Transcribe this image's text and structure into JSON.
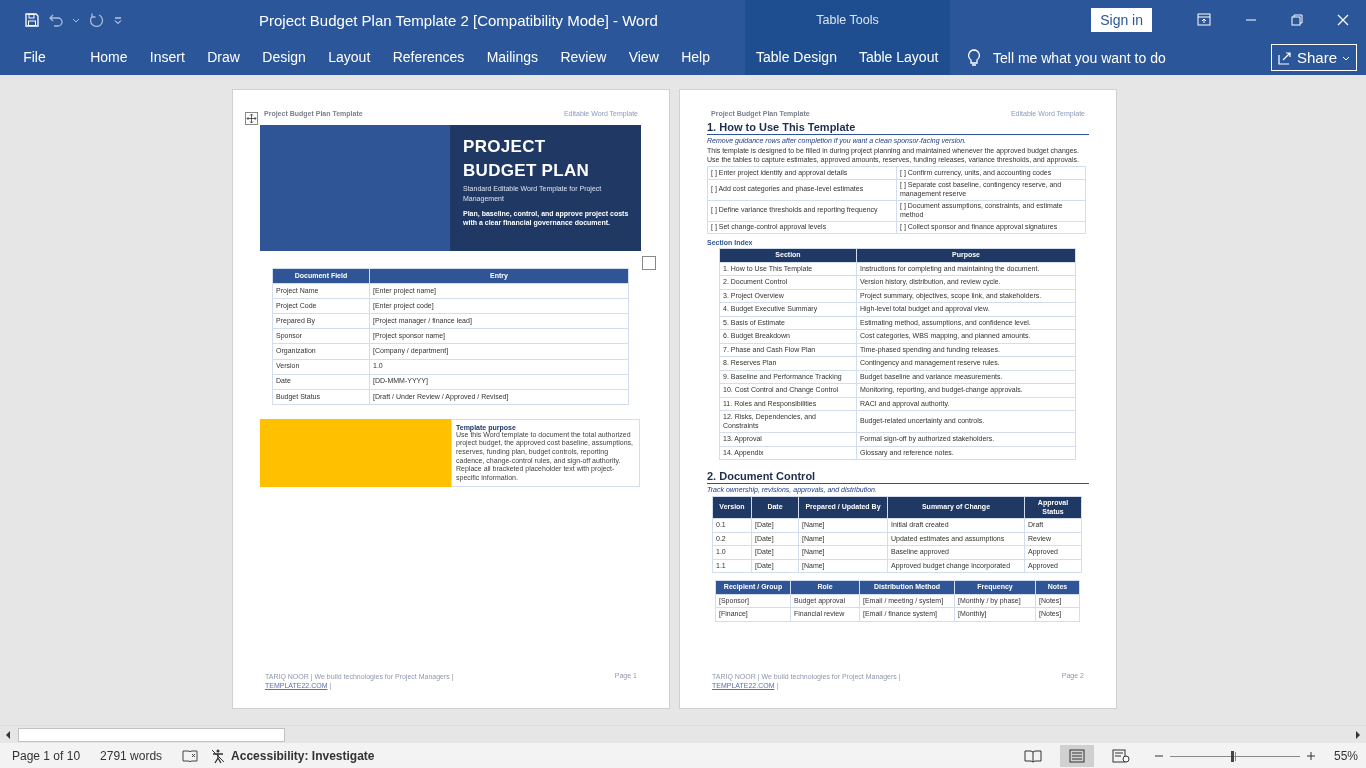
{
  "window": {
    "title": "Project Budget Plan Template 2 [Compatibility Mode]  -  Word",
    "contextual_group": "Table Tools",
    "sign_in": "Sign in"
  },
  "ribbon_tabs": [
    {
      "label": "File",
      "selected": false
    },
    {
      "label": "Home",
      "selected": false
    },
    {
      "label": "Insert",
      "selected": false
    },
    {
      "label": "Draw",
      "selected": false
    },
    {
      "label": "Design",
      "selected": false
    },
    {
      "label": "Layout",
      "selected": false
    },
    {
      "label": "References",
      "selected": false
    },
    {
      "label": "Mailings",
      "selected": false
    },
    {
      "label": "Review",
      "selected": false
    },
    {
      "label": "View",
      "selected": false
    },
    {
      "label": "Help",
      "selected": false
    }
  ],
  "table_tools_tabs": [
    {
      "label": "Table Design",
      "selected": false
    },
    {
      "label": "Table Layout",
      "selected": false
    }
  ],
  "tell_me": {
    "placeholder": "Tell me what you want to do"
  },
  "share": "Share",
  "page_1": {
    "header_left": "Project Budget Plan Template",
    "header_right": "Editable Word Template",
    "cover": {
      "title_lines": [
        "PROJECT",
        "BUDGET PLAN"
      ],
      "subtitle": "Standard Editable Word Template for Project Management",
      "tagline": "Plan, baseline, control, and approve project costs with a clear financial governance document."
    },
    "fields_table": {
      "columns": [
        "Document Field",
        "Entry"
      ],
      "rows": [
        [
          "Project Name",
          "[Enter project name]"
        ],
        [
          "Project Code",
          "[Enter project code]"
        ],
        [
          "Prepared By",
          "[Project manager / finance lead]"
        ],
        [
          "Sponsor",
          "[Project sponsor name]"
        ],
        [
          "Organization",
          "[Company / department]"
        ],
        [
          "Version",
          "1.0"
        ],
        [
          "Date",
          "[DD-MMM-YYYY]"
        ],
        [
          "Budget Status",
          "[Draft / Under Review / Approved / Revised]"
        ]
      ]
    },
    "purpose": {
      "heading": "Template purpose",
      "text": "Use this Word template to document the total authorized project budget, the approved cost baseline, assumptions, reserves, funding plan, budget controls, reporting cadence, change-control rules, and sign-off authority. Replace all bracketed placeholder text with project-specific information."
    },
    "footer": {
      "credit": "TARIQ NOOR | We build technologies for Project Managers |",
      "link": "TEMPLATE22.COM",
      "separator": "|",
      "page": "Page 1"
    }
  },
  "page_2": {
    "header_left": "Project Budget Plan Template",
    "header_right": "Editable Word Template",
    "section_1": {
      "heading": "1. How to Use This Template",
      "note": "Remove guidance rows after completion if you want a clean sponsor-facing version.",
      "intro": "This template is designed to be filled in during project planning and maintained whenever the approved budget changes. Use the tables to capture estimates, approved amounts, reserves, funding releases, variance thresholds, and approvals.",
      "checklist": [
        [
          "[ ] Enter project identity and approval details",
          "[ ] Confirm currency, units, and accounting codes"
        ],
        [
          "[ ] Add cost categories and phase-level estimates",
          "[ ] Separate cost baseline, contingency reserve, and management reserve"
        ],
        [
          "[ ] Define variance thresholds and reporting frequency",
          "[ ] Document assumptions, constraints, and estimate method"
        ],
        [
          "[ ] Set change-control approval levels",
          "[ ] Collect sponsor and finance approval signatures"
        ]
      ]
    },
    "section_index": {
      "heading": "Section Index",
      "columns": [
        "Section",
        "Purpose"
      ],
      "rows": [
        [
          "1. How to Use This Template",
          "Instructions for completing and maintaining the document."
        ],
        [
          "2. Document Control",
          "Version history, distribution, and review cycle."
        ],
        [
          "3. Project Overview",
          "Project summary, objectives, scope link, and stakeholders."
        ],
        [
          "4. Budget Executive Summary",
          "High-level total budget and approval view."
        ],
        [
          "5. Basis of Estimate",
          "Estimating method, assumptions, and confidence level."
        ],
        [
          "6. Budget Breakdown",
          "Cost categories, WBS mapping, and planned amounts."
        ],
        [
          "7. Phase and Cash Flow Plan",
          "Time-phased spending and funding releases."
        ],
        [
          "8. Reserves Plan",
          "Contingency and management reserve rules."
        ],
        [
          "9. Baseline and Performance Tracking",
          "Budget baseline and variance measurements."
        ],
        [
          "10. Cost Control and Change Control",
          "Monitoring, reporting, and budget-change approvals."
        ],
        [
          "11. Roles and Responsibilities",
          "RACI and approval authority."
        ],
        [
          "12. Risks, Dependencies, and Constraints",
          "Budget-related uncertainty and controls."
        ],
        [
          "13. Approval",
          "Formal sign-off by authorized stakeholders."
        ],
        [
          "14. Appendix",
          "Glossary and reference notes."
        ]
      ]
    },
    "section_2": {
      "heading": "2. Document Control",
      "note": "Track ownership, revisions, approvals, and distribution.",
      "version_table": {
        "columns": [
          "Version",
          "Date",
          "Prepared / Updated By",
          "Summary of Change",
          "Approval Status"
        ],
        "rows": [
          [
            "0.1",
            "[Date]",
            "[Name]",
            "Initial draft created",
            "Draft"
          ],
          [
            "0.2",
            "[Date]",
            "[Name]",
            "Updated estimates and assumptions",
            "Review"
          ],
          [
            "1.0",
            "[Date]",
            "[Name]",
            "Baseline approved",
            "Approved"
          ],
          [
            "1.1",
            "[Date]",
            "[Name]",
            "Approved budget change incorporated",
            "Approved"
          ]
        ]
      },
      "distribution_table": {
        "columns": [
          "Recipient / Group",
          "Role",
          "Distribution Method",
          "Frequency",
          "Notes"
        ],
        "rows": [
          [
            "[Sponsor]",
            "Budget approval",
            "[Email / meeting / system]",
            "[Monthly / by phase]",
            "[Notes]"
          ],
          [
            "[Finance]",
            "Financial review",
            "[Email / finance system]",
            "[Monthly]",
            "[Notes]"
          ]
        ]
      }
    },
    "footer": {
      "credit": "TARIQ NOOR | We build technologies for Project Managers |",
      "link": "TEMPLATE22.COM",
      "separator": "|",
      "page": "Page 2"
    }
  },
  "status_bar": {
    "page": "Page 1 of 10",
    "words": "2791 words",
    "accessibility": "Accessibility: Investigate",
    "views": [
      {
        "kind": "read",
        "selected": false
      },
      {
        "kind": "print",
        "selected": true
      },
      {
        "kind": "web",
        "selected": false
      }
    ],
    "zoom": {
      "level": 0.48,
      "reading": "55%"
    }
  }
}
